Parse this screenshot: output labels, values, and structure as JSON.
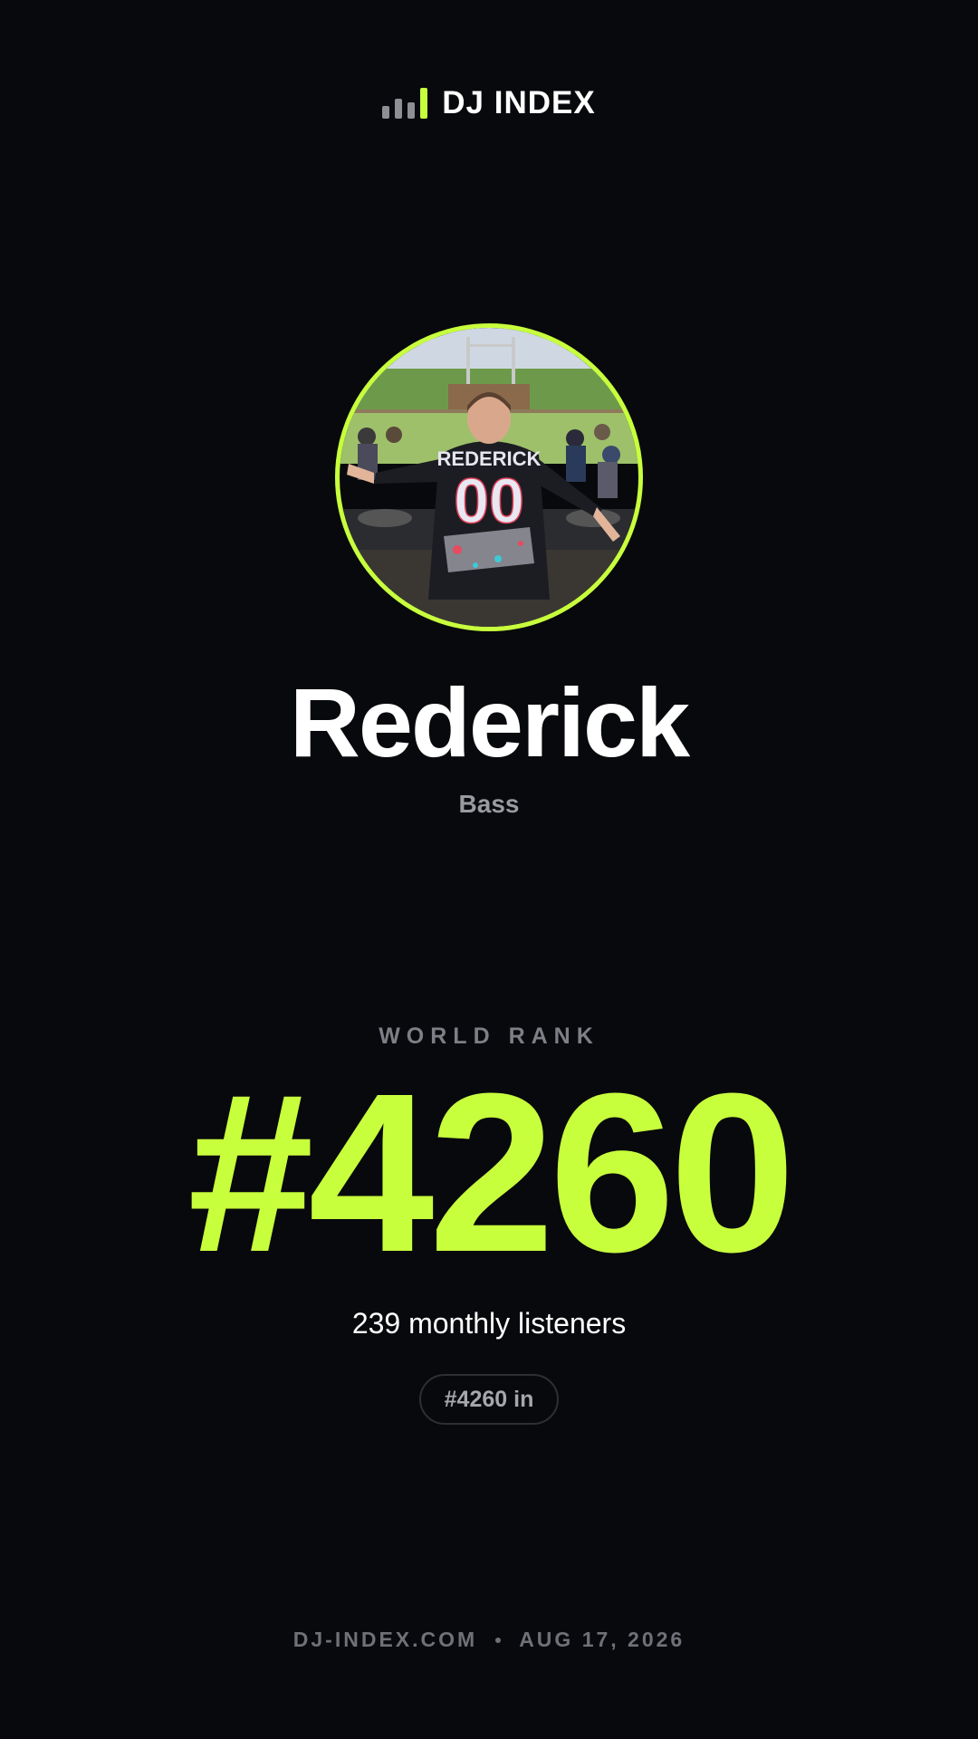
{
  "brand": {
    "name": "DJ INDEX",
    "icon": "bar-chart-icon",
    "accent_color": "#c8ff3d"
  },
  "artist": {
    "name": "Rederick",
    "genre": "Bass",
    "photo_icon": "artist-photo"
  },
  "rank": {
    "label": "WORLD RANK",
    "value": "#4260",
    "listeners": "239 monthly listeners",
    "pill": "#4260 in"
  },
  "footer": {
    "site": "DJ-INDEX.COM",
    "date": "AUG 17, 2026"
  },
  "colors": {
    "background": "#08090c",
    "accent": "#c8ff3d",
    "muted": "#7d7f86"
  }
}
